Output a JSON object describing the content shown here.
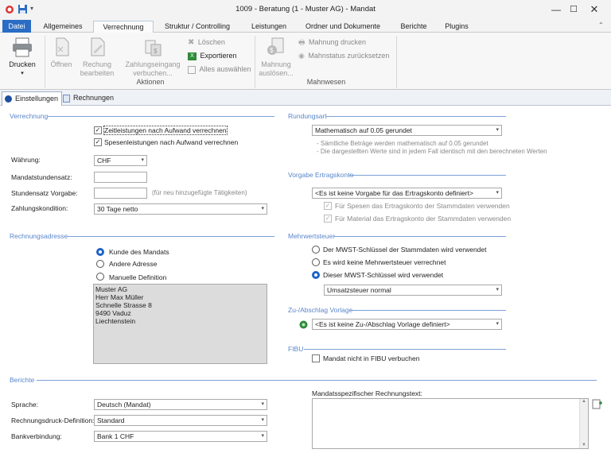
{
  "window": {
    "title": "1009 - Beratung (1 - Muster AG) - Mandat"
  },
  "ribbon_tabs": [
    "Datei",
    "Allgemeines",
    "Verrechnung",
    "Struktur / Controlling",
    "Leistungen",
    "Ordner und Dokumente",
    "Berichte",
    "Plugins"
  ],
  "ribbon": {
    "drucken": "Drucken",
    "oeffnen": "Öffnen",
    "rechnung_bearbeiten": [
      "Rechung",
      "bearbeiten"
    ],
    "zahlungseingang": [
      "Zahlungseingang",
      "verbuchen..."
    ],
    "loeschen": "Löschen",
    "exportieren": "Exportieren",
    "alles_auswaehlen": "Alles auswählen",
    "mahnung_ausloesen": [
      "Mahnung",
      "auslösen..."
    ],
    "mahnung_drucken": "Mahnung drucken",
    "mahnstatus": "Mahnstatus zurücksetzen",
    "group_aktionen": "Aktionen",
    "group_mahnwesen": "Mahnwesen"
  },
  "subtabs": [
    "Einstellungen",
    "Rechnungen"
  ],
  "verrechnung": {
    "header": "Verrechnung",
    "zeitleistungen": "Zeitleistungen nach Aufwand verrechnen",
    "spesenleistungen": "Spesenleistungen nach Aufwand verrechnen",
    "waehrung_label": "Währung:",
    "waehrung_value": "CHF",
    "mandatstundensatz_label": "Mandatstundensatz:",
    "stundensatz_label": "Stundensatz Vorgabe:",
    "stundensatz_hint": "(für neu hinzugefügte Tätigkeiten)",
    "zahlungskondition_label": "Zahlungskondition:",
    "zahlungskondition_value": "30 Tage netto"
  },
  "rechnungsadresse": {
    "header": "Rechnungsadresse",
    "opt1": "Kunde des Mandats",
    "opt2": "Andere Adresse",
    "opt3": "Manuelle Definition",
    "address": [
      "Muster AG",
      "Herr Max Müller",
      "Schnelle Strasse 8",
      "9490 Vaduz",
      "Liechtenstein"
    ]
  },
  "rundungsart": {
    "header": "Rundungsart",
    "value": "Mathematisch auf 0.05 gerundet",
    "note1": "- Sämtliche Beträge werden mathematisch auf 0.05 gerundet",
    "note2": "- Die dargestellten Werte sind in jedem Fall identisch mit den berechneten Werten"
  },
  "ertragskonto": {
    "header": "Vorgabe Ertragskonto",
    "value": "<Es ist keine Vorgabe für das Ertragskonto definiert>",
    "spesen": "Für Spesen das Ertragskonto der Stammdaten verwenden",
    "material": "Für Material das Ertragskonto der Stammdaten verwenden"
  },
  "mwst": {
    "header": "Mehrwertsteuer",
    "opt1": "Der MWST-Schlüssel der Stammdaten wird verwendet",
    "opt2": "Es wird keine Mehrwertsteuer verrechnet",
    "opt3": "Dieser MWST-Schlüssel wird verwendet",
    "value": "Umsatzsteuer normal"
  },
  "zuabschlag": {
    "header": "Zu-/Abschlag Vorlage",
    "value": "<Es ist keine Zu-/Abschlag Vorlage definiert>"
  },
  "fibu": {
    "header": "FIBU",
    "checkbox": "Mandat nicht in FIBU verbuchen"
  },
  "berichte": {
    "header": "Berichte",
    "sprache_label": "Sprache:",
    "sprache_value": "Deutsch (Mandat)",
    "druck_label": "Rechnungsdruck-Definition:",
    "druck_value": "Standard",
    "bank_label": "Bankverbindung:",
    "bank_value": "Bank 1 CHF",
    "rechnungstext_label": "Mandatsspezifischer Rechnungstext:"
  },
  "colors": {
    "accent": "#2b6cc4",
    "section": "#5a86c9",
    "radio_on": "#1d63c8"
  }
}
